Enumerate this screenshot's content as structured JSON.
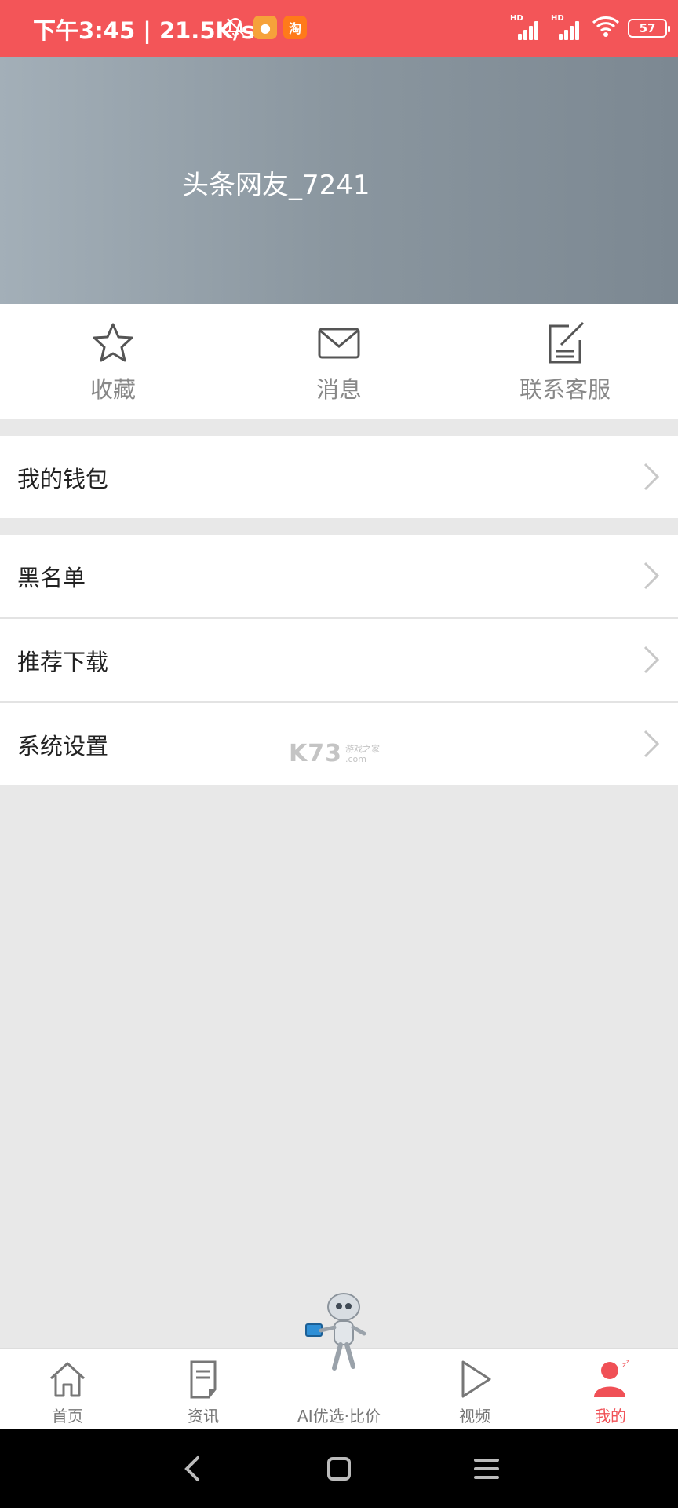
{
  "status_bar": {
    "time": "下午3:45",
    "separator": "|",
    "speed": "21.5K/s",
    "battery": "57",
    "hd1": "HD",
    "hd2": "HD",
    "app_icons": [
      {
        "name": "alarm-muted-icon"
      },
      {
        "name": "app-orange-icon",
        "color": "#f6a23a"
      },
      {
        "name": "taobao-icon",
        "glyph": "淘",
        "color": "#ff7a1a"
      }
    ],
    "colors": {
      "background": "#f35558"
    }
  },
  "profile": {
    "username": "头条网友_7241"
  },
  "quick_actions": [
    {
      "label": "收藏",
      "icon": "star-icon"
    },
    {
      "label": "消息",
      "icon": "mail-icon"
    },
    {
      "label": "联系客服",
      "icon": "edit-note-icon"
    }
  ],
  "menu": {
    "wallet": "我的钱包",
    "blacklist": "黑名单",
    "recommend": "推荐下载",
    "settings": "系统设置"
  },
  "watermark": {
    "main": "K73",
    "sub_top": "游戏之家",
    "sub_bottom": ".com"
  },
  "bottom_nav": [
    {
      "label": "首页",
      "icon": "home-icon"
    },
    {
      "label": "资讯",
      "icon": "news-icon"
    },
    {
      "label": "AI优选·比价",
      "icon": "robot-icon"
    },
    {
      "label": "视频",
      "icon": "play-icon"
    },
    {
      "label": "我的",
      "icon": "user-icon",
      "active": true
    }
  ],
  "colors": {
    "accent": "#f05056",
    "header_gradient_start": "#a3afb8",
    "header_gradient_end": "#7c8892"
  }
}
